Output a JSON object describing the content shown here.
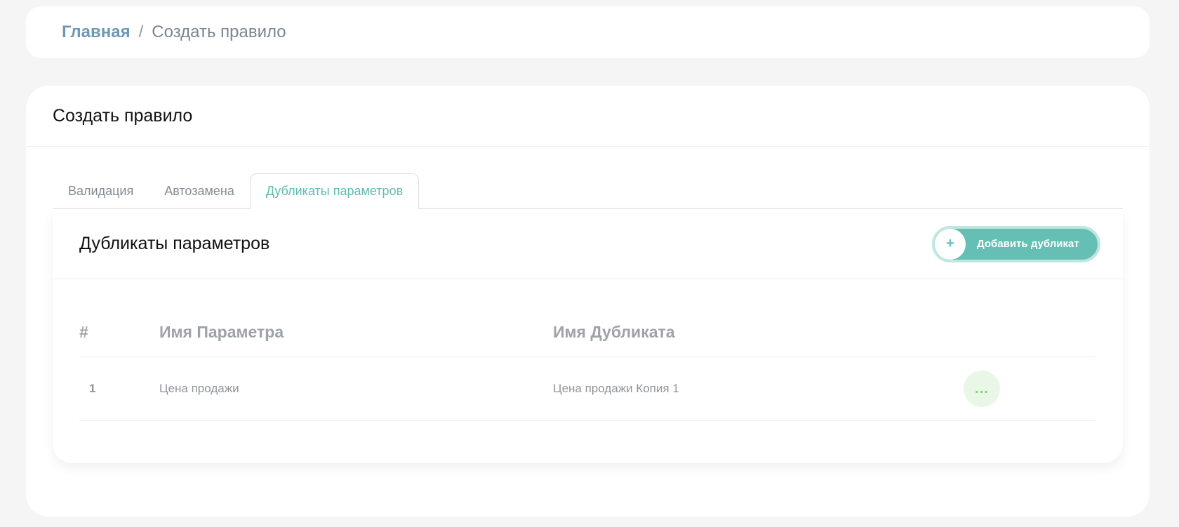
{
  "breadcrumb": {
    "home": "Главная",
    "separator": "/",
    "current": "Создать правило"
  },
  "main": {
    "title": "Создать правило",
    "tabs": [
      {
        "label": "Валидация",
        "active": false
      },
      {
        "label": "Автозамена",
        "active": false
      },
      {
        "label": "Дубликаты параметров",
        "active": true
      }
    ]
  },
  "duplicates": {
    "title": "Дубликаты параметров",
    "add_button": {
      "icon": "plus-icon",
      "glyph": "+",
      "label": "Добавить дубликат"
    },
    "table": {
      "headers": {
        "num": "#",
        "param_name": "Имя Параметра",
        "duplicate_name": "Имя Дубликата"
      },
      "rows": [
        {
          "num": "1",
          "param_name": "Цена продажи",
          "duplicate_name": "Цена продажи Копия 1",
          "actions_glyph": "..."
        }
      ]
    }
  },
  "colors": {
    "accent": "#66bfb4",
    "breadcrumb_home": "#6e98b4",
    "more_button_bg": "#e9f7e6",
    "more_button_fg": "#7ed36f"
  }
}
